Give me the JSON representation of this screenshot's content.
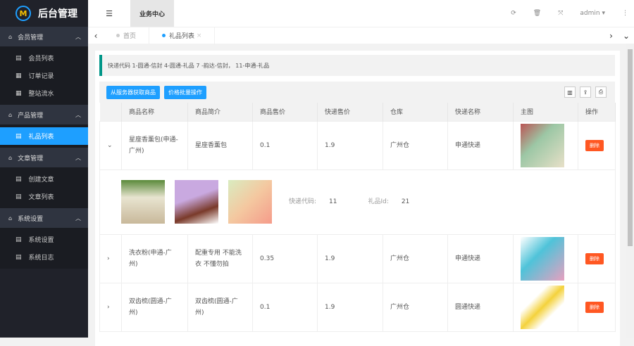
{
  "app": {
    "title": "后台管理",
    "logo_glyph": "M"
  },
  "sidebar": {
    "groups": [
      {
        "label": "会员管理",
        "items": [
          {
            "label": "会员列表"
          },
          {
            "label": "订单记录"
          },
          {
            "label": "整站流水"
          }
        ]
      },
      {
        "label": "产品管理",
        "items": [
          {
            "label": "礼品列表",
            "active": true
          }
        ]
      },
      {
        "label": "文章管理",
        "items": [
          {
            "label": "创建文章"
          },
          {
            "label": "文章列表"
          }
        ]
      },
      {
        "label": "系统设置",
        "items": [
          {
            "label": "系统设置"
          },
          {
            "label": "系统日志"
          }
        ]
      }
    ]
  },
  "header": {
    "menu_icon": "☰",
    "biz_tab": "业务中心",
    "user": "admin"
  },
  "tabs": [
    {
      "label": "首页"
    },
    {
      "label": "礼品列表",
      "close": "×"
    }
  ],
  "note": "快递代码 1-圆通-信封 4-圆通-礼品 7 -韵达-信封， 11-申通-礼品",
  "toolbar": {
    "fetch": "从服务器获取商品",
    "batch": "价格批量操作"
  },
  "table": {
    "headers": [
      "商品名称",
      "商品简介",
      "商品售价",
      "快递售价",
      "仓库",
      "快递名称",
      "主图",
      "操作"
    ],
    "rows": [
      {
        "name": "星座香薰包(申通-广州)",
        "intro": "星座香薰包",
        "price": "0.1",
        "ship": "1.9",
        "wh": "广州仓",
        "express": "申通快递",
        "del": "删除",
        "expanded": true,
        "img": "#9cc7a5"
      },
      {
        "name": "洗衣粉(申通-广州)",
        "intro": "配重专用 不能洗衣 不懂勿拍",
        "price": "0.35",
        "ship": "1.9",
        "wh": "广州仓",
        "express": "申通快递",
        "del": "删除",
        "img": "#4fc3d9"
      },
      {
        "name": "双齿梳(圆通-广州)",
        "intro": "双齿梳(圆通-广州)",
        "price": "0.1",
        "ship": "1.9",
        "wh": "广州仓",
        "express": "圆通快递",
        "del": "删除",
        "img": "#f4d23c"
      }
    ],
    "detail": {
      "code_label": "快递代码:",
      "code": "11",
      "id_label": "礼品Id:",
      "id": "21"
    }
  }
}
